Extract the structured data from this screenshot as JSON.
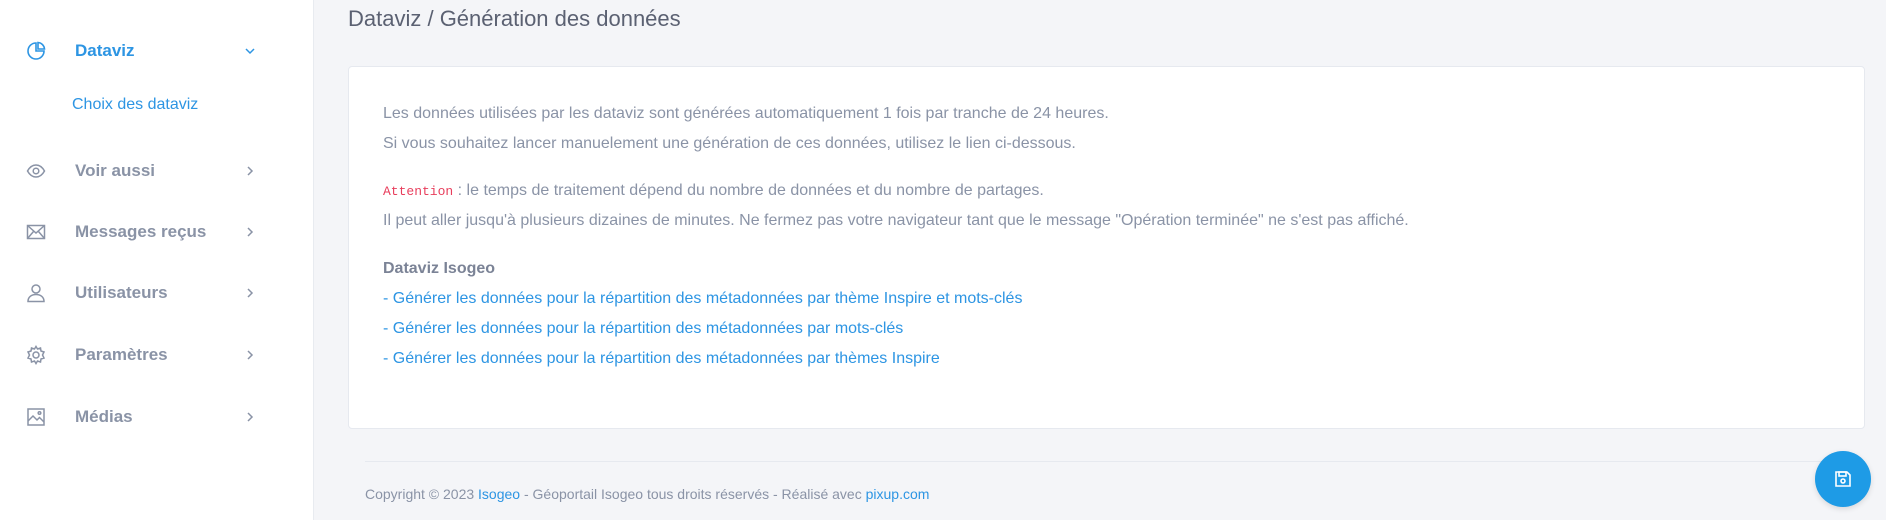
{
  "colors": {
    "accent": "#2d95e3",
    "text": "#8a93a6",
    "title": "#5b6172",
    "code": "#e83e5c",
    "fab": "#1e9be6"
  },
  "sidebar": {
    "items": [
      {
        "label": "Dataviz",
        "icon": "pie-chart-icon",
        "active": true,
        "expanded": true,
        "children": [
          {
            "label": "Choix des dataviz"
          }
        ]
      },
      {
        "label": "Voir aussi",
        "icon": "eye-icon"
      },
      {
        "label": "Messages reçus",
        "icon": "mail-icon"
      },
      {
        "label": "Utilisateurs",
        "icon": "user-icon"
      },
      {
        "label": "Paramètres",
        "icon": "gear-icon"
      },
      {
        "label": "Médias",
        "icon": "image-icon"
      }
    ]
  },
  "page": {
    "title": "Dataviz / Génération des données"
  },
  "content": {
    "intro_line1": "Les données utilisées par les dataviz sont générées automatiquement 1 fois par tranche de 24 heures.",
    "intro_line2": "Si vous souhaitez lancer manuelement une génération de ces données, utilisez le lien ci-dessous.",
    "attention_label": "Attention",
    "attention_text": " : le temps de traitement dépend du nombre de données et du nombre de partages.",
    "warning_line": "Il peut aller jusqu'à plusieurs dizaines de minutes. Ne fermez pas votre navigateur tant que le message \"Opération terminée\" ne s'est pas affiché.",
    "section_heading": "Dataviz Isogeo",
    "links": [
      "- Générer les données pour la répartition des métadonnées par thème Inspire et mots-clés",
      "- Générer les données pour la répartition des métadonnées par mots-clés",
      "- Générer les données pour la répartition des métadonnées par thèmes Inspire"
    ]
  },
  "footer": {
    "prefix": "Copyright © 2023 ",
    "brand_link": "Isogeo",
    "middle": " - Géoportail Isogeo tous droits réservés - Réalisé avec ",
    "maker_link": "pixup.com"
  },
  "fab": {
    "icon": "save-icon"
  }
}
